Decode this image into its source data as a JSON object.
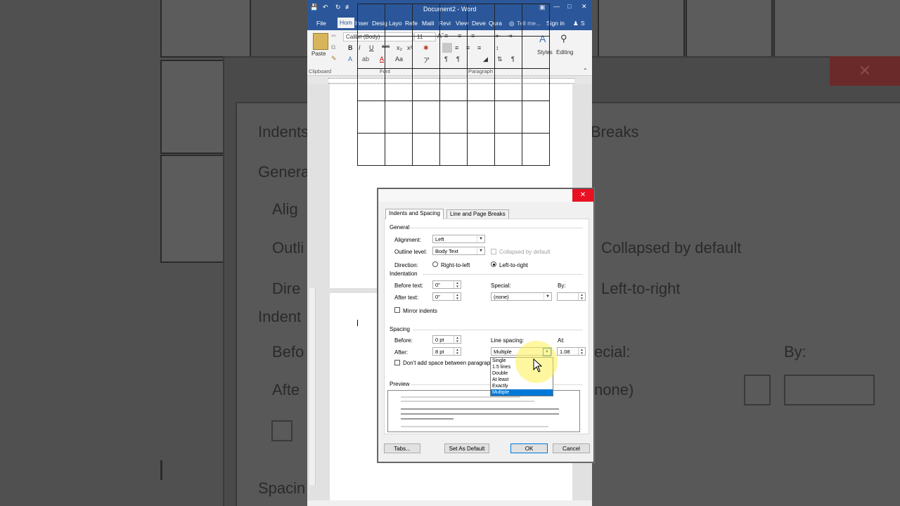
{
  "background": {
    "tab_labels": [
      "Indents and Spacing",
      "Breaks"
    ],
    "general": "General",
    "alignment": "Alig",
    "outline": "Outli",
    "direction": "Dire",
    "indentation": "Indent",
    "before": "Befo",
    "after": "Afte",
    "spacing": "Spacin",
    "collapsed": "Collapsed by default",
    "ltr": "Left-to-right",
    "special": "ecial:",
    "by": "By:",
    "none": "none)",
    "close": "✕"
  },
  "word": {
    "title": "Document2 - Word",
    "tabs": [
      "File",
      "Hom",
      "Inser",
      "Desig",
      "Layo",
      "Refe",
      "Maili",
      "Revi",
      "View",
      "Deve",
      "Qura"
    ],
    "tell_me": "Tell me...",
    "sign_in": "Sign in",
    "share": "S",
    "font_name": "Calibri (Body)",
    "font_size": "11",
    "paste": "Paste",
    "styles": "Styles",
    "editing": "Editing",
    "groups": [
      "Clipboard",
      "Font",
      "Paragraph"
    ]
  },
  "dialog": {
    "title": "Paragraph",
    "tabs": [
      "Indents and Spacing",
      "Line and Page Breaks"
    ],
    "general": {
      "heading": "General",
      "alignment_label": "Alignment:",
      "alignment_value": "Left",
      "outline_label": "Outline level:",
      "outline_value": "Body Text",
      "collapsed_label": "Collapsed by default",
      "direction_label": "Direction:",
      "rtl_label": "Right-to-left",
      "ltr_label": "Left-to-right"
    },
    "indentation": {
      "heading": "Indentation",
      "before_label": "Before text:",
      "before_value": "0\"",
      "after_label": "After text:",
      "after_value": "0\"",
      "special_label": "Special:",
      "special_value": "(none)",
      "by_label": "By:",
      "by_value": "",
      "mirror_label": "Mirror indents"
    },
    "spacing": {
      "heading": "Spacing",
      "before_label": "Before:",
      "before_value": "0 pt",
      "after_label": "After:",
      "after_value": "8 pt",
      "line_spacing_label": "Line spacing:",
      "line_spacing_value": "Multiple",
      "at_label": "At:",
      "at_value": "1.08",
      "dont_add_label": "Don't add space between paragrap",
      "options": [
        "Single",
        "1.5 lines",
        "Double",
        "At least",
        "Exactly",
        "Multiple"
      ],
      "selected_option": "Multiple"
    },
    "preview_heading": "Preview",
    "buttons": {
      "tabs": "Tabs...",
      "set_default": "Set As Default",
      "ok": "OK",
      "cancel": "Cancel"
    }
  }
}
